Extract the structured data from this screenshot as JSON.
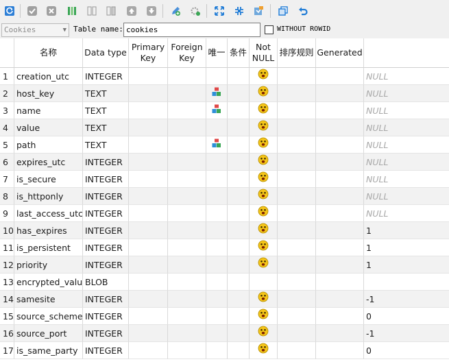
{
  "toolbar": {
    "buttons": [
      "refresh-icon",
      "confirm-icon",
      "cancel-icon",
      "add-column-icon",
      "insert-column-icon",
      "delete-column-icon",
      "move-up-icon",
      "move-down-icon",
      "edit-index-icon",
      "settings-icon",
      "expand-icon",
      "collapse-icon",
      "export-icon",
      "copy-icon",
      "undo-icon"
    ]
  },
  "namebar": {
    "schema": "Cookies",
    "table_name_label": "Table name:",
    "table_name": "cookies",
    "without_rowid_label": "WITHOUT ROWID",
    "without_rowid_checked": false
  },
  "columns": {
    "name": "名称",
    "type": "Data type",
    "pk": "Primary Key",
    "fk": "Foreign Key",
    "unique": "唯一",
    "check": "条件",
    "notnull": "Not NULL",
    "collate": "排序规则",
    "generated": "Generated"
  },
  "rows": [
    {
      "num": "1",
      "name": "creation_utc",
      "type": "INTEGER",
      "unique": false,
      "notnull": true,
      "default": "NULL",
      "is_null": true
    },
    {
      "num": "2",
      "name": "host_key",
      "type": "TEXT",
      "unique": true,
      "notnull": true,
      "default": "NULL",
      "is_null": true
    },
    {
      "num": "3",
      "name": "name",
      "type": "TEXT",
      "unique": true,
      "notnull": true,
      "default": "NULL",
      "is_null": true
    },
    {
      "num": "4",
      "name": "value",
      "type": "TEXT",
      "unique": false,
      "notnull": true,
      "default": "NULL",
      "is_null": true
    },
    {
      "num": "5",
      "name": "path",
      "type": "TEXT",
      "unique": true,
      "notnull": true,
      "default": "NULL",
      "is_null": true
    },
    {
      "num": "6",
      "name": "expires_utc",
      "type": "INTEGER",
      "unique": false,
      "notnull": true,
      "default": "NULL",
      "is_null": true
    },
    {
      "num": "7",
      "name": "is_secure",
      "type": "INTEGER",
      "unique": false,
      "notnull": true,
      "default": "NULL",
      "is_null": true
    },
    {
      "num": "8",
      "name": "is_httponly",
      "type": "INTEGER",
      "unique": false,
      "notnull": true,
      "default": "NULL",
      "is_null": true
    },
    {
      "num": "9",
      "name": "last_access_utc",
      "type": "INTEGER",
      "unique": false,
      "notnull": true,
      "default": "NULL",
      "is_null": true
    },
    {
      "num": "10",
      "name": "has_expires",
      "type": "INTEGER",
      "unique": false,
      "notnull": true,
      "default": "1",
      "is_null": false
    },
    {
      "num": "11",
      "name": "is_persistent",
      "type": "INTEGER",
      "unique": false,
      "notnull": true,
      "default": "1",
      "is_null": false
    },
    {
      "num": "12",
      "name": "priority",
      "type": "INTEGER",
      "unique": false,
      "notnull": true,
      "default": "1",
      "is_null": false
    },
    {
      "num": "13",
      "name": "encrypted_value",
      "type": "BLOB",
      "unique": false,
      "notnull": false,
      "default": "",
      "is_null": false
    },
    {
      "num": "14",
      "name": "samesite",
      "type": "INTEGER",
      "unique": false,
      "notnull": true,
      "default": "-1",
      "is_null": false
    },
    {
      "num": "15",
      "name": "source_scheme",
      "type": "INTEGER",
      "unique": false,
      "notnull": true,
      "default": "0",
      "is_null": false
    },
    {
      "num": "16",
      "name": "source_port",
      "type": "INTEGER",
      "unique": false,
      "notnull": true,
      "default": "-1",
      "is_null": false
    },
    {
      "num": "17",
      "name": "is_same_party",
      "type": "INTEGER",
      "unique": false,
      "notnull": true,
      "default": "0",
      "is_null": false
    }
  ],
  "icons": {
    "unique": "unique-index-icon",
    "notnull": "not-null-face-icon"
  },
  "colors": {
    "null_text": "#a8a8a8",
    "alt_row": "#f2f2f2",
    "face_yellow": "#f5c518",
    "accent_blue": "#1e7bd6"
  }
}
